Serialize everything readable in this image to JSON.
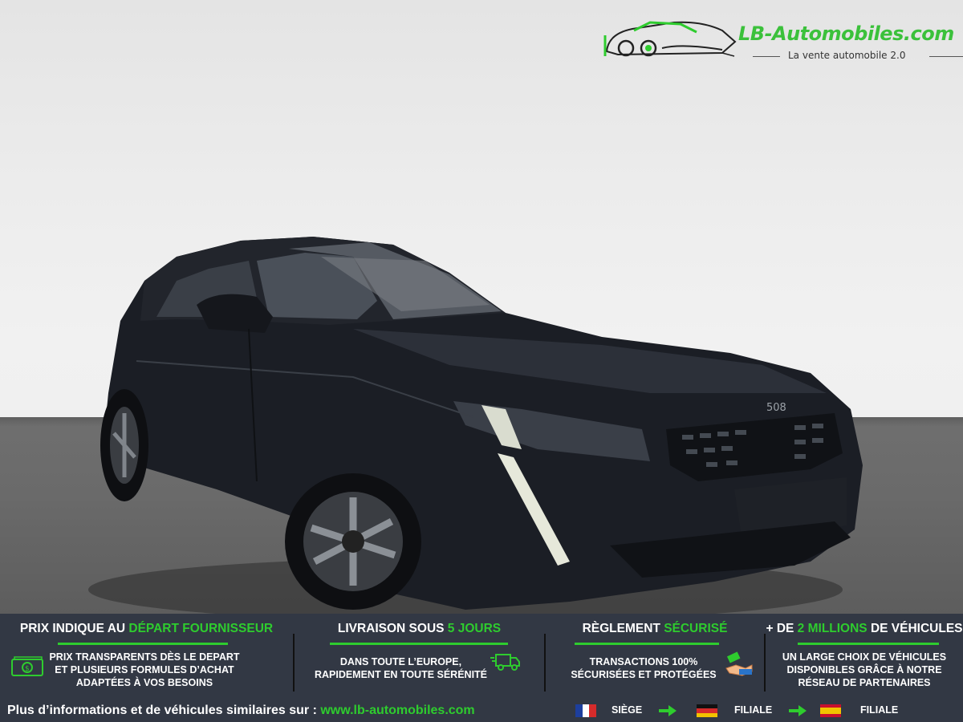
{
  "brand": {
    "name": "LB-Automobiles.com",
    "tagline": "La vente automobile 2.0",
    "accent_color": "#2ecc2e"
  },
  "photo": {
    "car_badge": "508"
  },
  "features": [
    {
      "title_pre": "PRIX INDIQUE AU ",
      "title_hl": "DÉPART FOURNISSEUR",
      "title_post": "",
      "lines": [
        "PRIX TRANSPARENTS DÈS LE DEPART",
        "ET PLUSIEURS FORMULES D’ACHAT",
        "ADAPTÉES À VOS BESOINS"
      ],
      "icon": "money-icon"
    },
    {
      "title_pre": "LIVRAISON SOUS ",
      "title_hl": "5 JOURS",
      "title_post": "",
      "lines": [
        "DANS TOUTE L’EUROPE,",
        "RAPIDEMENT EN TOUTE SÉRÉNITÉ"
      ],
      "icon": "truck-icon"
    },
    {
      "title_pre": "RÈGLEMENT ",
      "title_hl": "SÉCURISÉ",
      "title_post": "",
      "lines": [
        "TRANSACTIONS 100%",
        "SÉCURISÉES ET PROTÉGÉES"
      ],
      "icon": "payment-hand-icon"
    },
    {
      "title_pre": "+ DE ",
      "title_hl": "2 MILLIONS",
      "title_post": " DE VÉHICULES",
      "lines": [
        "UN LARGE CHOIX DE VÉHICULES",
        "DISPONIBLES GRÂCE À NOTRE",
        "RÉSEAU DE PARTENAIRES"
      ],
      "icon": ""
    }
  ],
  "footer": {
    "text": "Plus d’informations et de véhicules similaires sur : ",
    "url": "www.lb-automobiles.com",
    "locations": [
      {
        "flag": "france-flag",
        "label": "SIÈGE"
      },
      {
        "flag": "germany-flag",
        "label": "FILIALE"
      },
      {
        "flag": "spain-flag",
        "label": "FILIALE"
      }
    ]
  }
}
